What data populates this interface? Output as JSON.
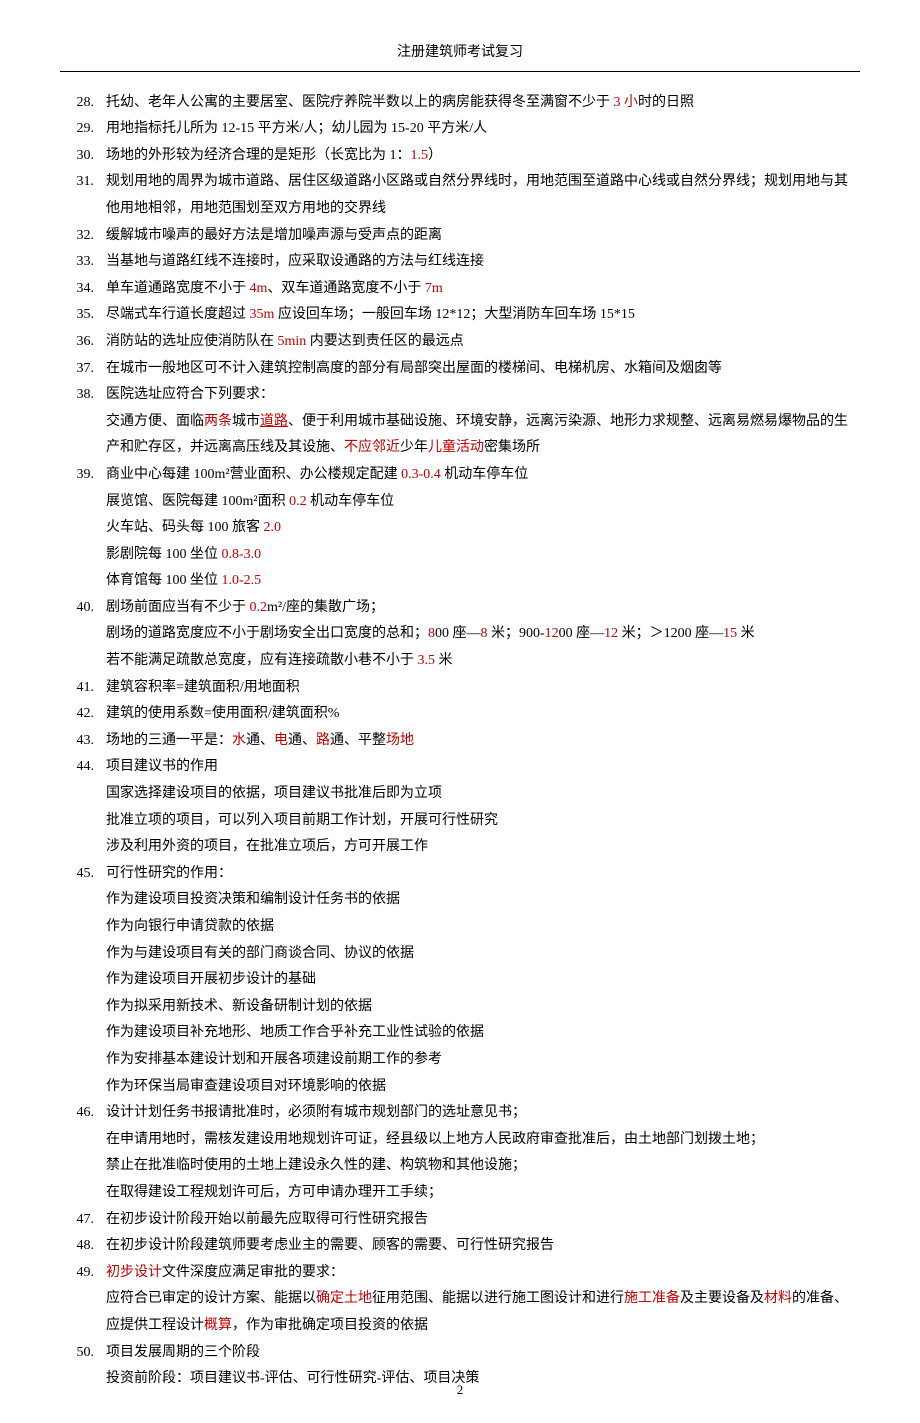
{
  "header_title": "注册建筑师考试复习",
  "page_number": "2",
  "items": [
    {
      "num": "28.",
      "lines": [
        [
          {
            "t": "托幼、老年人公寓的主要居室、医院疗养院半数以上的病房能获得冬至满窗不少于 "
          },
          {
            "t": "3 小",
            "c": "red"
          },
          {
            "t": "时的日照"
          }
        ]
      ]
    },
    {
      "num": "29.",
      "lines": [
        [
          {
            "t": "用地指标托儿所为 12-15 平方米/人；幼儿园为 15-20 平方米/人"
          }
        ]
      ]
    },
    {
      "num": "30.",
      "lines": [
        [
          {
            "t": "场地的外形较为经济合理的是矩形（长宽比为 1："
          },
          {
            "t": "1.5",
            "c": "red"
          },
          {
            "t": "）"
          }
        ]
      ]
    },
    {
      "num": "31.",
      "lines": [
        [
          {
            "t": "规划用地的周界为城市道路、居住区级道路小区路或自然分界线时，用地范围至道路中心线或自然分界线；规划用地与其他用地相邻，用地范围划至双方用地的交界线"
          }
        ]
      ]
    },
    {
      "num": "32.",
      "lines": [
        [
          {
            "t": "缓解城市噪声的最好方法是增加噪声源与受声点的距离"
          }
        ]
      ]
    },
    {
      "num": "33.",
      "lines": [
        [
          {
            "t": "当基地与道路红线不连接时，应采取设通路的方法与红线连接"
          }
        ]
      ]
    },
    {
      "num": "34.",
      "lines": [
        [
          {
            "t": "单车道通路宽度不小于 "
          },
          {
            "t": "4m",
            "c": "red"
          },
          {
            "t": "、双车道通路宽度不小于 "
          },
          {
            "t": "7m",
            "c": "red"
          }
        ]
      ]
    },
    {
      "num": "35.",
      "lines": [
        [
          {
            "t": "尽端式车行道长度超过 "
          },
          {
            "t": "35m",
            "c": "red"
          },
          {
            "t": " 应设回车场；一般回车场 12*12；大型消防车回车场 15*15"
          }
        ]
      ]
    },
    {
      "num": "36.",
      "lines": [
        [
          {
            "t": "消防站的选址应使消防队在 "
          },
          {
            "t": "5min",
            "c": "red"
          },
          {
            "t": " 内要达到责任区的最远点"
          }
        ]
      ]
    },
    {
      "num": "37.",
      "lines": [
        [
          {
            "t": "在城市一般地区可不计入建筑控制高度的部分有局部突出屋面的楼梯间、电梯机房、水箱间及烟囱等"
          }
        ]
      ]
    },
    {
      "num": "38.",
      "lines": [
        [
          {
            "t": "医院选址应符合下列要求："
          }
        ],
        [
          {
            "t": "交通方便、面临"
          },
          {
            "t": "两条",
            "c": "red"
          },
          {
            "t": "城市"
          },
          {
            "t": "道路",
            "c": "red",
            "u": true
          },
          {
            "t": "、便于利用城市基础设施、环境安静，远离污染源、地形力求规整、远离易燃易爆物品的生产和贮存区，并远离高压线及其设施、"
          },
          {
            "t": "不应邻近",
            "c": "red"
          },
          {
            "t": "少年"
          },
          {
            "t": "儿童活动",
            "c": "red"
          },
          {
            "t": "密集场所"
          }
        ]
      ]
    },
    {
      "num": "39.",
      "lines": [
        [
          {
            "t": "商业中心每建 100m²营业面积、办公楼规定配建 "
          },
          {
            "t": "0.3-0.4",
            "c": "red"
          },
          {
            "t": " 机动车停车位"
          }
        ],
        [
          {
            "t": "展览馆、医院每建 100m²面积 "
          },
          {
            "t": "0.2",
            "c": "red"
          },
          {
            "t": " 机动车停车位"
          }
        ],
        [
          {
            "t": "火车站、码头每 100 旅客 "
          },
          {
            "t": "2.0",
            "c": "red"
          }
        ],
        [
          {
            "t": "影剧院每 100 坐位 "
          },
          {
            "t": "0.8-3.0",
            "c": "red"
          }
        ],
        [
          {
            "t": "体育馆每 100 坐位 "
          },
          {
            "t": "1.0-2.5",
            "c": "red"
          }
        ]
      ]
    },
    {
      "num": "40.",
      "lines": [
        [
          {
            "t": "剧场前面应当有不少于 "
          },
          {
            "t": "0.2",
            "c": "red"
          },
          {
            "t": "m²/座的集散广场；"
          }
        ],
        [
          {
            "t": "剧场的道路宽度应不小于剧场安全出口宽度的总和；"
          },
          {
            "t": "8",
            "c": "red"
          },
          {
            "t": "00 座—"
          },
          {
            "t": "8",
            "c": "red"
          },
          {
            "t": " 米；900-"
          },
          {
            "t": "12",
            "c": "red"
          },
          {
            "t": "00 座—"
          },
          {
            "t": "12",
            "c": "red"
          },
          {
            "t": " 米；＞1200 座—"
          },
          {
            "t": "15",
            "c": "red"
          },
          {
            "t": " 米"
          }
        ],
        [
          {
            "t": "若不能满足疏散总宽度，应有连接疏散小巷不小于 "
          },
          {
            "t": "3.5",
            "c": "red"
          },
          {
            "t": " 米"
          }
        ]
      ]
    },
    {
      "num": "41.",
      "lines": [
        [
          {
            "t": "建筑容积率=建筑面积/用地面积"
          }
        ]
      ]
    },
    {
      "num": "42.",
      "lines": [
        [
          {
            "t": "建筑的使用系数=使用面积/建筑面积%"
          }
        ]
      ]
    },
    {
      "num": "43.",
      "lines": [
        [
          {
            "t": "场地的三通一平是："
          },
          {
            "t": "水",
            "c": "red"
          },
          {
            "t": "通、"
          },
          {
            "t": "电",
            "c": "red"
          },
          {
            "t": "通、"
          },
          {
            "t": "路",
            "c": "red"
          },
          {
            "t": "通、平整"
          },
          {
            "t": "场地",
            "c": "red"
          }
        ]
      ]
    },
    {
      "num": "44.",
      "lines": [
        [
          {
            "t": "项目建议书的作用"
          }
        ],
        [
          {
            "t": "国家选择建设项目的依据，项目建议书批准后即为立项"
          }
        ],
        [
          {
            "t": "批准立项的项目，可以列入项目前期工作计划，开展可行性研究"
          }
        ],
        [
          {
            "t": "涉及利用外资的项目，在批准立项后，方可开展工作"
          }
        ]
      ]
    },
    {
      "num": "45.",
      "lines": [
        [
          {
            "t": "可行性研究的作用："
          }
        ],
        [
          {
            "t": "作为建设项目投资决策和编制设计任务书的依据"
          }
        ],
        [
          {
            "t": "作为向银行申请贷款的依据"
          }
        ],
        [
          {
            "t": "作为与建设项目有关的部门商谈合同、协议的依据"
          }
        ],
        [
          {
            "t": "作为建设项目开展初步设计的基础"
          }
        ],
        [
          {
            "t": "作为拟采用新技术、新设备研制计划的依据"
          }
        ],
        [
          {
            "t": "作为建设项目补充地形、地质工作合乎补充工业性试验的依据"
          }
        ],
        [
          {
            "t": "作为安排基本建设计划和开展各项建设前期工作的参考"
          }
        ],
        [
          {
            "t": "作为环保当局审查建设项目对环境影响的依据"
          }
        ]
      ]
    },
    {
      "num": "46.",
      "lines": [
        [
          {
            "t": "设计计划任务书报请批准时，必须附有城市规划部门的选址意见书；"
          }
        ],
        [
          {
            "t": "在申请用地时，需核发建设用地规划许可证，经县级以上地方人民政府审查批准后，由土地部门划拨土地；"
          }
        ],
        [
          {
            "t": "禁止在批准临时使用的土地上建设永久性的建、构筑物和其他设施；"
          }
        ],
        [
          {
            "t": "在取得建设工程规划许可后，方可申请办理开工手续；"
          }
        ]
      ]
    },
    {
      "num": "47.",
      "lines": [
        [
          {
            "t": "在初步设计阶段开始以前最先应取得可行性研究报告"
          }
        ]
      ]
    },
    {
      "num": "48.",
      "lines": [
        [
          {
            "t": "在初步设计阶段建筑师要考虑业主的需要、顾客的需要、可行性研究报告"
          }
        ]
      ]
    },
    {
      "num": "49.",
      "lines": [
        [
          {
            "t": "初步设计",
            "c": "red"
          },
          {
            "t": "文件深度应满足审批的要求："
          }
        ],
        [
          {
            "t": "应符合已审定的设计方案、能据以"
          },
          {
            "t": "确定土地",
            "c": "red"
          },
          {
            "t": "征用范围、能据以进行施工图设计和进行"
          },
          {
            "t": "施工准备",
            "c": "red"
          },
          {
            "t": "及主要设备及"
          },
          {
            "t": "材料",
            "c": "red"
          },
          {
            "t": "的准备、应提供工程设计"
          },
          {
            "t": "概算",
            "c": "red"
          },
          {
            "t": "，作为审批确定项目投资的依据"
          }
        ]
      ]
    },
    {
      "num": "50.",
      "lines": [
        [
          {
            "t": "项目发展周期的三个阶段"
          }
        ],
        [
          {
            "t": "投资前阶段：项目建议书-评估、可行性研究-评估、项目决策"
          }
        ]
      ]
    }
  ]
}
